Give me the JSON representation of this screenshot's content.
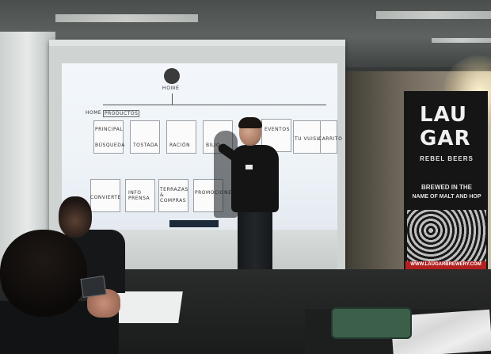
{
  "scene": {
    "description_free": true
  },
  "screen": {
    "home_label": "HOME",
    "logo_text": "LAU CAR"
  },
  "sketch_notes": [
    {
      "text": "PRINCIPAL"
    },
    {
      "text": "BÚSQUEDA"
    },
    {
      "text": "TOSTADA"
    },
    {
      "text": "RACIÓN"
    },
    {
      "text": "BILIO"
    },
    {
      "text": "EVENTOS"
    },
    {
      "text": "TU VUISUPER"
    },
    {
      "text": "CARRITO"
    },
    {
      "text": "CONVIERTE"
    },
    {
      "text": "INFO PRENSA"
    },
    {
      "text": "TERRAZAS & COMPRAS"
    },
    {
      "text": "PROMOCIONES"
    }
  ],
  "sketch_header": {
    "home_tag": "HOME",
    "productos_tag": "PRODUCTOS"
  },
  "banner": {
    "brand_line1": "LAU",
    "brand_line2": "GAR",
    "subtitle": "REBEL BEERS",
    "tagline_1": "BREWED IN THE",
    "tagline_2": "NAME OF MALT AND HOP",
    "url": "WWW.LAUGARBREWERY.COM"
  },
  "colors": {
    "projection": "#f1f5f9",
    "banner_bg": "#151515",
    "banner_accent": "#b32020",
    "bag": "#3c5f4a"
  }
}
